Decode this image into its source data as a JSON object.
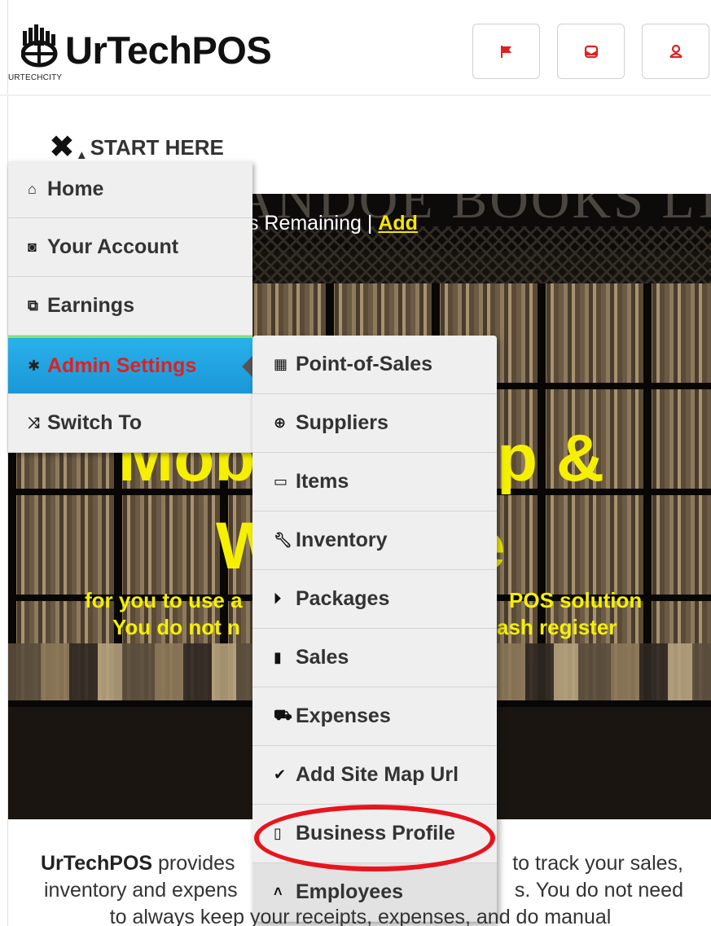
{
  "header": {
    "brand_name": "UrTechPOS",
    "brand_sub": "URTECHCITY",
    "buttons": [
      {
        "icon": "flag-icon"
      },
      {
        "icon": "inbox-icon"
      },
      {
        "icon": "user-icon"
      }
    ],
    "accent_color": "#e02020"
  },
  "start_here": {
    "label": "START HERE"
  },
  "side_menu": {
    "items": [
      {
        "label": "Home",
        "icon": "home-icon"
      },
      {
        "label": "Your Account",
        "icon": "account-icon"
      },
      {
        "label": "Earnings",
        "icon": "earnings-icon"
      },
      {
        "label": "Admin Settings",
        "icon": "gear-icon",
        "active": true
      },
      {
        "label": "Switch To",
        "icon": "shuffle-icon"
      }
    ],
    "active_color": "#1b97d8"
  },
  "sub_menu": {
    "items": [
      {
        "label": "Point-of-Sales",
        "icon": "keyboard-icon"
      },
      {
        "label": "Suppliers",
        "icon": "plus-circle-icon"
      },
      {
        "label": "Items",
        "icon": "tag-icon"
      },
      {
        "label": "Inventory",
        "icon": "wrench-icon"
      },
      {
        "label": "Packages",
        "icon": "play-circle-icon"
      },
      {
        "label": "Sales",
        "icon": "book-icon"
      },
      {
        "label": "Expenses",
        "icon": "cart-icon"
      },
      {
        "label": "Add Site Map Url",
        "icon": "check-circle-icon"
      },
      {
        "label": "Business Profile",
        "icon": "briefcase-icon"
      },
      {
        "label": "Employees",
        "icon": "chevron-up-icon"
      }
    ],
    "highlight_color": "#e8141e"
  },
  "hero": {
    "sign_text": "ANDOE BOOKS LT",
    "credits_text": "ts Remaining | ",
    "add_link": "Add",
    "big_line_1_left": "Mob",
    "big_line_1_right": "p &",
    "big_line_2_left": "W",
    "big_line_2_right": "e",
    "sub_line_1_left": "for you to use a",
    "sub_line_1_right": "POS solution",
    "sub_line_2_left": "You do not n",
    "sub_line_2_right": "ash register",
    "text_color": "#f5f000"
  },
  "body": {
    "brand_bold": "UrTechPOS",
    "line_1_rest": " provides",
    "line_1_right": "to track your sales,",
    "line_2_left": "inventory and expens",
    "line_2_right": "s. You do not need",
    "line_3": "to always keep your receipts, expenses, and do manual"
  }
}
